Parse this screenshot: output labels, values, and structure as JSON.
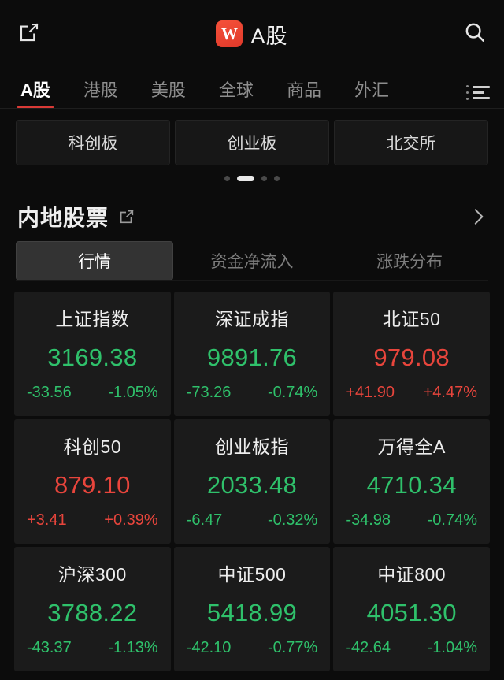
{
  "header": {
    "share_icon": "share-export-icon",
    "logo_letter": "W",
    "title": "A股",
    "search_icon": "search-icon"
  },
  "tabs": {
    "items": [
      {
        "label": "A股",
        "active": true
      },
      {
        "label": "港股",
        "active": false
      },
      {
        "label": "美股",
        "active": false
      },
      {
        "label": "全球",
        "active": false
      },
      {
        "label": "商品",
        "active": false
      },
      {
        "label": "外汇",
        "active": false
      }
    ],
    "menu_icon": "list-menu-icon",
    "active_underline_color": "#d93a36"
  },
  "chips": {
    "items": [
      {
        "label": "科创板"
      },
      {
        "label": "创业板"
      },
      {
        "label": "北交所"
      }
    ]
  },
  "pager": {
    "count": 4,
    "active_index": 1
  },
  "section": {
    "title": "内地股票",
    "external_link_icon": "external-link-icon",
    "chevron_icon": "chevron-right-icon"
  },
  "segments": {
    "items": [
      {
        "label": "行情",
        "active": true
      },
      {
        "label": "资金净流入",
        "active": false
      },
      {
        "label": "涨跌分布",
        "active": false
      }
    ]
  },
  "colors": {
    "up": "#e8453c",
    "down": "#2fc16b",
    "page_bg": "#0c0c0c",
    "card_bg": "#1b1b1b"
  },
  "indices": [
    {
      "name": "上证指数",
      "price": "3169.38",
      "change": "-33.56",
      "percent": "-1.05%",
      "direction": "down"
    },
    {
      "name": "深证成指",
      "price": "9891.76",
      "change": "-73.26",
      "percent": "-0.74%",
      "direction": "down"
    },
    {
      "name": "北证50",
      "price": "979.08",
      "change": "+41.90",
      "percent": "+4.47%",
      "direction": "up"
    },
    {
      "name": "科创50",
      "price": "879.10",
      "change": "+3.41",
      "percent": "+0.39%",
      "direction": "up"
    },
    {
      "name": "创业板指",
      "price": "2033.48",
      "change": "-6.47",
      "percent": "-0.32%",
      "direction": "down"
    },
    {
      "name": "万得全A",
      "price": "4710.34",
      "change": "-34.98",
      "percent": "-0.74%",
      "direction": "down"
    },
    {
      "name": "沪深300",
      "price": "3788.22",
      "change": "-43.37",
      "percent": "-1.13%",
      "direction": "down"
    },
    {
      "name": "中证500",
      "price": "5418.99",
      "change": "-42.10",
      "percent": "-0.77%",
      "direction": "down"
    },
    {
      "name": "中证800",
      "price": "4051.30",
      "change": "-42.64",
      "percent": "-1.04%",
      "direction": "down"
    }
  ]
}
